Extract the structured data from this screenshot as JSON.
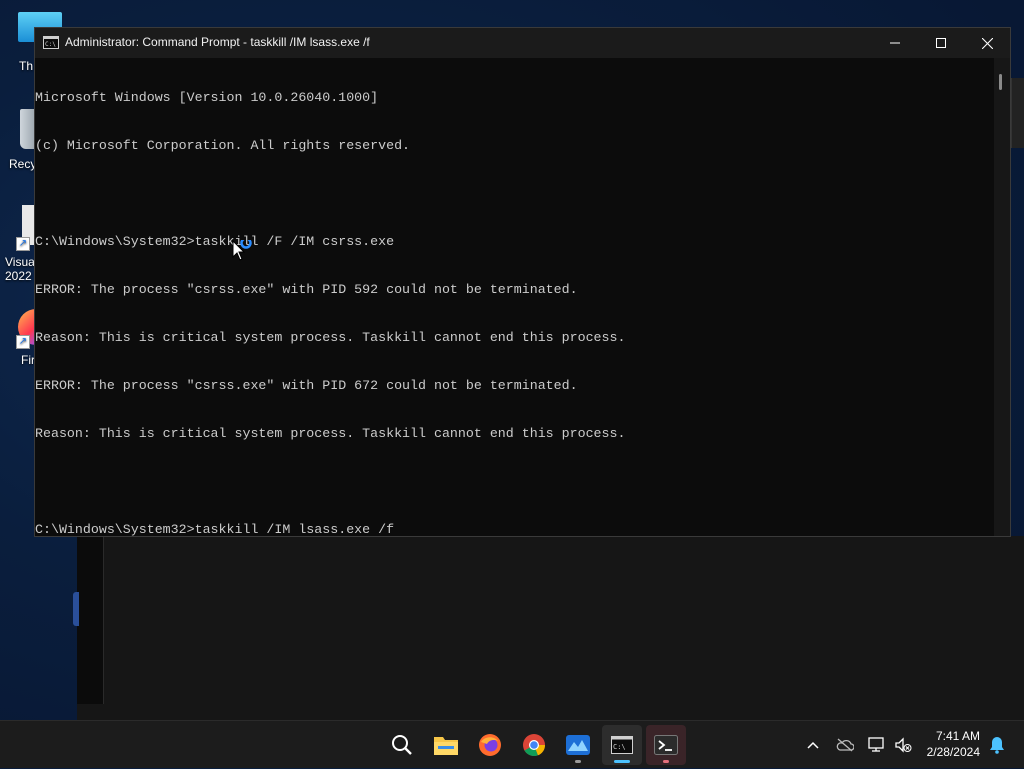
{
  "window": {
    "title": "Administrator: Command Prompt - taskkill  /IM lsass.exe /f",
    "console_lines": [
      "Microsoft Windows [Version 10.0.26040.1000]",
      "(c) Microsoft Corporation. All rights reserved.",
      "",
      "C:\\Windows\\System32>taskkill /F /IM csrss.exe",
      "ERROR: The process \"csrss.exe\" with PID 592 could not be terminated.",
      "Reason: This is critical system process. Taskkill cannot end this process.",
      "ERROR: The process \"csrss.exe\" with PID 672 could not be terminated.",
      "Reason: This is critical system process. Taskkill cannot end this process.",
      "",
      "C:\\Windows\\System32>taskkill /IM lsass.exe /f"
    ]
  },
  "desktop": {
    "icons": [
      {
        "label": "Th",
        "icon": "this-pc-icon"
      },
      {
        "label": "Recy",
        "icon": "recycle-bin-icon"
      },
      {
        "label": "Visua",
        "label2": "2022 I",
        "icon": "visual-studio-icon"
      },
      {
        "label": "Fir",
        "icon": "firefox-icon"
      }
    ]
  },
  "taskbar": {
    "items": [
      "search-icon",
      "file-explorer-icon",
      "firefox-icon",
      "chrome-icon",
      "photos-icon",
      "command-prompt-icon",
      "terminal-icon"
    ],
    "tray_icons": [
      "chevron-up-icon",
      "onedrive-icon",
      "network-icon",
      "volume-muted-icon",
      "notification-bell-icon"
    ],
    "time": "7:41 AM",
    "date": "2/28/2024"
  },
  "colors": {
    "console_bg": "#0c0c0c",
    "console_text": "#cccccc",
    "accent": "#4cc2ff"
  }
}
